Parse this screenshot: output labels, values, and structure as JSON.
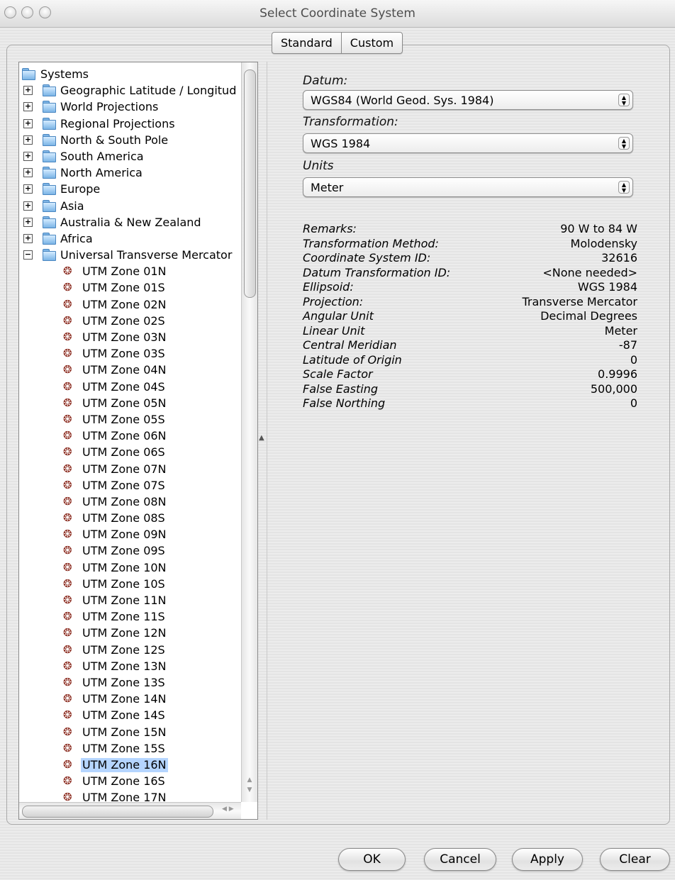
{
  "window": {
    "title": "Select Coordinate System"
  },
  "tabs": [
    {
      "label": "Standard"
    },
    {
      "label": "Custom"
    }
  ],
  "tree": {
    "root_label": "Systems",
    "categories": [
      "Geographic Latitude / Longitud",
      "World Projections",
      "Regional Projections",
      "North & South Pole",
      "South America",
      "North America",
      "Europe",
      "Asia",
      "Australia & New Zealand",
      "Africa"
    ],
    "expanded_category": "Universal Transverse Mercator",
    "utm_zones": [
      "UTM Zone 01N",
      "UTM Zone 01S",
      "UTM Zone 02N",
      "UTM Zone 02S",
      "UTM Zone 03N",
      "UTM Zone 03S",
      "UTM Zone 04N",
      "UTM Zone 04S",
      "UTM Zone 05N",
      "UTM Zone 05S",
      "UTM Zone 06N",
      "UTM Zone 06S",
      "UTM Zone 07N",
      "UTM Zone 07S",
      "UTM Zone 08N",
      "UTM Zone 08S",
      "UTM Zone 09N",
      "UTM Zone 09S",
      "UTM Zone 10N",
      "UTM Zone 10S",
      "UTM Zone 11N",
      "UTM Zone 11S",
      "UTM Zone 12N",
      "UTM Zone 12S",
      "UTM Zone 13N",
      "UTM Zone 13S",
      "UTM Zone 14N",
      "UTM Zone 14S",
      "UTM Zone 15N",
      "UTM Zone 15S",
      "UTM Zone 16N",
      "UTM Zone 16S",
      "UTM Zone 17N"
    ],
    "selected_item": "UTM Zone 16N"
  },
  "datum": {
    "label": "Datum:",
    "value": "WGS84 (World Geod. Sys. 1984)"
  },
  "transformation": {
    "label": "Transformation:",
    "value": "WGS 1984"
  },
  "units": {
    "label": "Units",
    "value": "Meter"
  },
  "properties": [
    {
      "key": "Remarks:",
      "value": "90 W to 84 W"
    },
    {
      "key": "Transformation Method:",
      "value": "Molodensky"
    },
    {
      "key": "Coordinate System ID:",
      "value": "32616"
    },
    {
      "key": "Datum Transformation ID:",
      "value": "<None needed>"
    },
    {
      "key": "Ellipsoid:",
      "value": "WGS 1984"
    },
    {
      "key": "Projection:",
      "value": "Transverse Mercator"
    },
    {
      "key": "Angular Unit",
      "value": "Decimal Degrees"
    },
    {
      "key": "Linear Unit",
      "value": "Meter"
    },
    {
      "key": "Central Meridian",
      "value": "-87"
    },
    {
      "key": "Latitude of Origin",
      "value": "0"
    },
    {
      "key": "Scale Factor",
      "value": "0.9996"
    },
    {
      "key": "False Easting",
      "value": "500,000"
    },
    {
      "key": "False Northing",
      "value": "0"
    }
  ],
  "buttons": {
    "ok": "OK",
    "cancel": "Cancel",
    "apply": "Apply",
    "clear": "Clear"
  },
  "colors": {
    "selection": "#b5d5ff",
    "folder": "#7ab4e6"
  }
}
